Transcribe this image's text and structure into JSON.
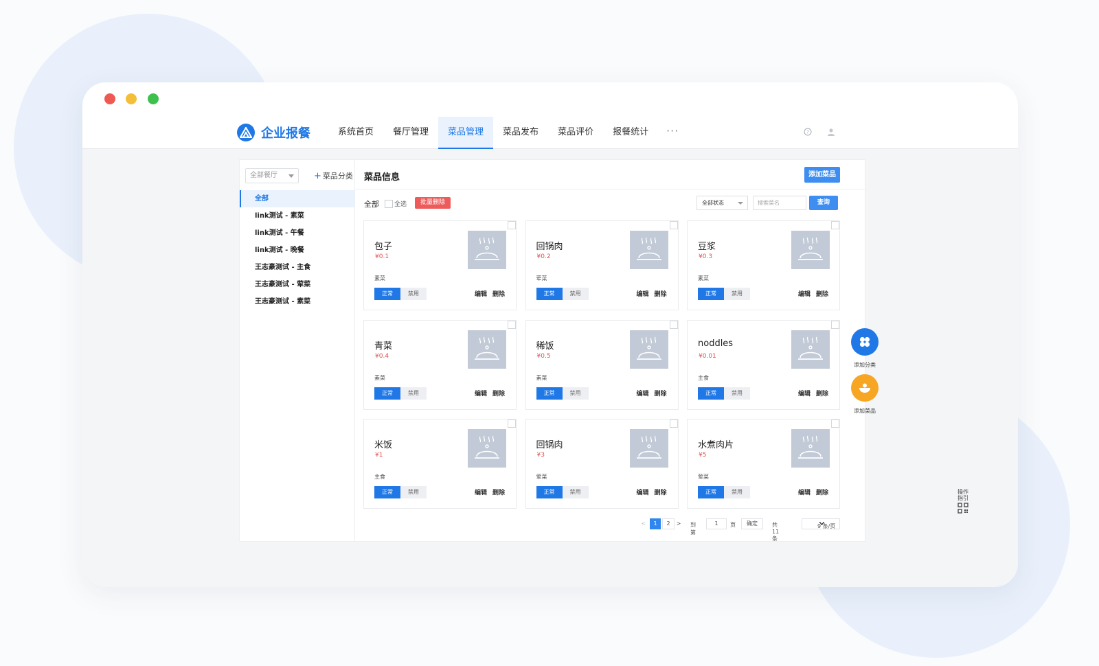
{
  "app": {
    "title": "企业报餐"
  },
  "nav": {
    "items": [
      "系统首页",
      "餐厅管理",
      "菜品管理",
      "菜品发布",
      "菜品评价",
      "报餐统计"
    ],
    "active": "菜品管理",
    "more": "···"
  },
  "sidebar": {
    "restaurant_select": "全部餐厅",
    "add_category": "菜品分类",
    "items": [
      "全部",
      "link测试 - 素菜",
      "link测试 - 午餐",
      "link测试 - 晚餐",
      "王志豪测试 - 主食",
      "王志豪测试 - 荤菜",
      "王志豪测试 - 素菜"
    ],
    "active": "全部"
  },
  "main": {
    "title": "菜品信息",
    "add_dish": "添加菜品",
    "filter_all": "全部",
    "select_all": "全选",
    "batch_delete": "批量删除",
    "status_select": "全部状态",
    "search_placeholder": "搜索菜名",
    "query": "查询"
  },
  "card_labels": {
    "normal": "正常",
    "disable": "禁用",
    "edit": "编辑",
    "delete": "删除"
  },
  "dishes": [
    {
      "name": "包子",
      "price": "¥0.1",
      "category": "素菜"
    },
    {
      "name": "回锅肉",
      "price": "¥0.2",
      "category": "荤菜"
    },
    {
      "name": "豆浆",
      "price": "¥0.3",
      "category": "素菜"
    },
    {
      "name": "青菜",
      "price": "¥0.4",
      "category": "素菜"
    },
    {
      "name": "稀饭",
      "price": "¥0.5",
      "category": "素菜"
    },
    {
      "name": "noddles",
      "price": "¥0.01",
      "category": "主食"
    },
    {
      "name": "米饭",
      "price": "¥1",
      "category": "主食"
    },
    {
      "name": "回锅肉",
      "price": "¥3",
      "category": "荤菜"
    },
    {
      "name": "水煮肉片",
      "price": "¥5",
      "category": "荤菜"
    }
  ],
  "pagination": {
    "prev": "<",
    "pages": [
      "1",
      "2"
    ],
    "current": "1",
    "next": ">",
    "goto_label": "到第",
    "goto_value": "1",
    "page_unit": "页",
    "confirm": "确定",
    "total": "共 11 条",
    "page_size": "9 条/页"
  },
  "floating": {
    "add_category": "添加分类",
    "add_dish": "添加菜品",
    "guide": "操作指引"
  },
  "colors": {
    "primary": "#1f78e6",
    "danger": "#ed5b5b",
    "accent_orange": "#f6a623"
  }
}
